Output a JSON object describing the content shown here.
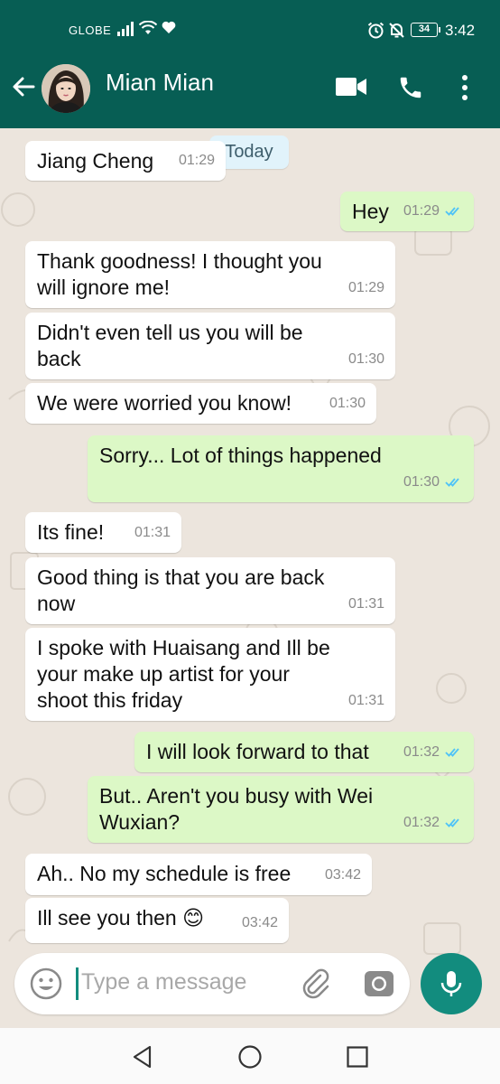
{
  "status_bar": {
    "carrier": "GLOBE",
    "battery": "34",
    "time": "3:42",
    "icons": [
      "signal-icon",
      "wifi-icon",
      "heart-icon",
      "alarm-icon",
      "bell-off-icon",
      "battery-icon"
    ]
  },
  "header": {
    "contact_name": "Mian Mian",
    "icons": [
      "back-arrow-icon",
      "video-call-icon",
      "phone-icon",
      "more-vert-icon"
    ]
  },
  "chat": {
    "date_label": "Today",
    "messages": [
      {
        "dir": "in",
        "text": "Jiang Cheng",
        "time": "01:29"
      },
      {
        "dir": "out",
        "text": "Hey",
        "time": "01:29",
        "read": true
      },
      {
        "dir": "in",
        "text": "Thank goodness! I thought you will ignore me!",
        "time": "01:29"
      },
      {
        "dir": "in",
        "text": "Didn't even tell us you will be back",
        "time": "01:30"
      },
      {
        "dir": "in",
        "text": "We were worried you know!",
        "time": "01:30"
      },
      {
        "dir": "out",
        "text": "Sorry... Lot of things happened",
        "time": "01:30",
        "read": true
      },
      {
        "dir": "in",
        "text": "Its fine!",
        "time": "01:31"
      },
      {
        "dir": "in",
        "text": "Good thing is that you are back now",
        "time": "01:31"
      },
      {
        "dir": "in",
        "text": "I spoke with Huaisang and Ill be your make up artist for your shoot this friday",
        "time": "01:31"
      },
      {
        "dir": "out",
        "text": "I will look forward to that",
        "time": "01:32",
        "read": true
      },
      {
        "dir": "out",
        "text": "But.. Aren't you busy with Wei Wuxian?",
        "time": "01:32",
        "read": true
      },
      {
        "dir": "in",
        "text": "Ah.. No my schedule is free",
        "time": "03:42"
      },
      {
        "dir": "in",
        "text": "Ill see you then 😊",
        "time": "03:42"
      }
    ]
  },
  "composer": {
    "placeholder": "Type a message",
    "icons": [
      "emoji-icon",
      "attach-icon",
      "camera-icon",
      "mic-icon"
    ]
  },
  "colors": {
    "primary": "#075E54",
    "accent": "#128C7E",
    "outgoing_bubble": "#DCF8C6",
    "incoming_bubble": "#FFFFFF",
    "chat_background": "#ECE5DD",
    "read_tick": "#4FC3F7"
  }
}
